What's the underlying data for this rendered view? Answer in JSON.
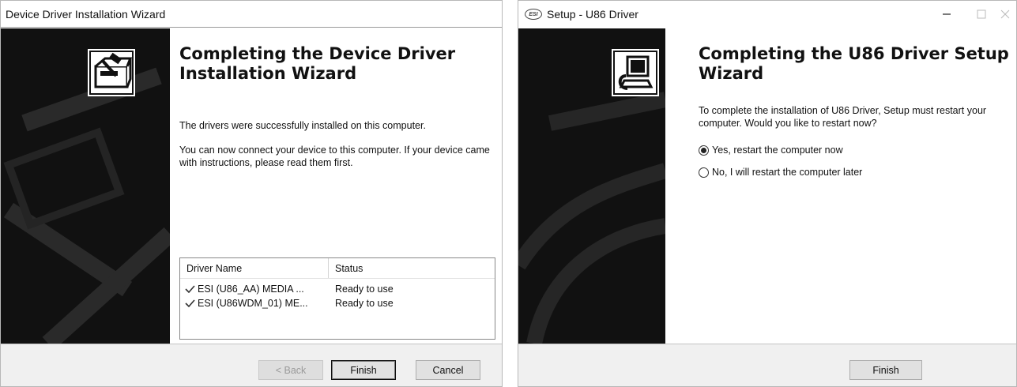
{
  "window1": {
    "title": "Device Driver Installation Wizard",
    "heading": "Completing the Device Driver Installation Wizard",
    "message1": "The drivers were successfully installed on this computer.",
    "message2": "You can now connect your device to this computer. If your device came with instructions, please read them first.",
    "table": {
      "columns": [
        "Driver Name",
        "Status"
      ],
      "rows": [
        {
          "name": "ESI (U86_AA) MEDIA ...",
          "status": "Ready to use"
        },
        {
          "name": "ESI (U86WDM_01) ME...",
          "status": "Ready to use"
        }
      ]
    },
    "buttons": {
      "back": "< Back",
      "finish": "Finish",
      "cancel": "Cancel"
    },
    "icons": {
      "wizard": "hardware-install-icon",
      "row_status": "checkmark-icon"
    }
  },
  "window2": {
    "title": "Setup - U86 Driver",
    "app_icon_text": "ESI",
    "heading": "Completing the U86 Driver Setup Wizard",
    "message": "To complete the installation of U86 Driver, Setup must restart your computer. Would you like to restart now?",
    "options": [
      {
        "label": "Yes, restart the computer now",
        "selected": true
      },
      {
        "label": "No, I will restart the computer later",
        "selected": false
      }
    ],
    "buttons": {
      "finish": "Finish"
    },
    "icons": {
      "wizard": "computer-setup-icon",
      "minimize": "minimize-icon",
      "maximize": "maximize-icon",
      "close": "close-icon"
    }
  },
  "colors": {
    "sidebar": "#111111",
    "footer": "#f0f0f0",
    "button": "#e1e1e1"
  }
}
